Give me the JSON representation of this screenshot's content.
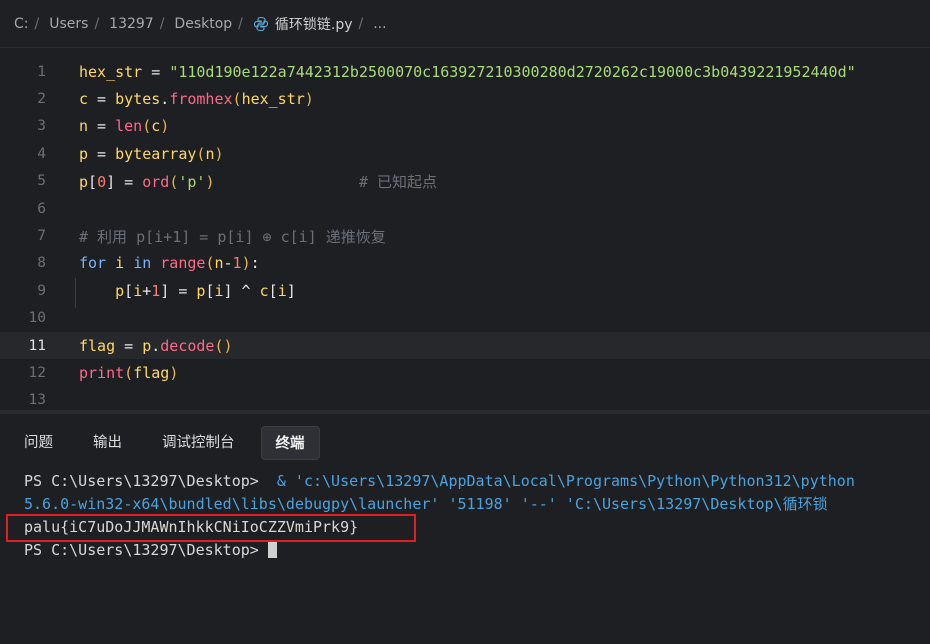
{
  "breadcrumb": {
    "items": [
      "C:",
      "Users",
      "13297",
      "Desktop",
      "循环锁链.py",
      "..."
    ],
    "separator": "/"
  },
  "editor": {
    "active_line": 11,
    "lines": [
      {
        "no": "1",
        "text": "hex_str = \"110d190e122a7442312b2500070c163927210300280d2720262c19000c3b0439221952440d\""
      },
      {
        "no": "2",
        "text": "c = bytes.fromhex(hex_str)"
      },
      {
        "no": "3",
        "text": "n = len(c)"
      },
      {
        "no": "4",
        "text": "p = bytearray(n)"
      },
      {
        "no": "5",
        "text": "p[0] = ord('p')                # 已知起点"
      },
      {
        "no": "6",
        "text": ""
      },
      {
        "no": "7",
        "text": "# 利用 p[i+1] = p[i] ⊕ c[i] 递推恢复"
      },
      {
        "no": "8",
        "text": "for i in range(n-1):"
      },
      {
        "no": "9",
        "text": "    p[i+1] = p[i] ^ c[i]"
      },
      {
        "no": "10",
        "text": ""
      },
      {
        "no": "11",
        "text": "flag = p.decode()"
      },
      {
        "no": "12",
        "text": "print(flag)"
      },
      {
        "no": "13",
        "text": ""
      }
    ]
  },
  "panel": {
    "tabs": [
      {
        "label": "问题",
        "active": false
      },
      {
        "label": "输出",
        "active": false
      },
      {
        "label": "调试控制台",
        "active": false
      },
      {
        "label": "终端",
        "active": true
      }
    ]
  },
  "terminal": {
    "prompt": "PS C:\\Users\\13297\\Desktop> ",
    "line1_cmd": " & 'c:\\Users\\13297\\AppData\\Local\\Programs\\Python\\Python312\\python",
    "line2": "5.6.0-win32-x64\\bundled\\libs\\debugpy\\launcher' '51198' '--' 'C:\\Users\\13297\\Desktop\\循环锁",
    "output": "palu{iC7uDoJJMAWnIhkkCNiIoCZZVmiPrk9}",
    "prompt2": "PS C:\\Users\\13297\\Desktop> "
  },
  "colors": {
    "background": "#1e1f22",
    "string": "#a9dc76",
    "keyword": "#78b4f5",
    "function": "#fc6a8a",
    "variable": "#ffd866",
    "highlight_box": "#e02020",
    "terminal_path": "#4aa3df"
  }
}
